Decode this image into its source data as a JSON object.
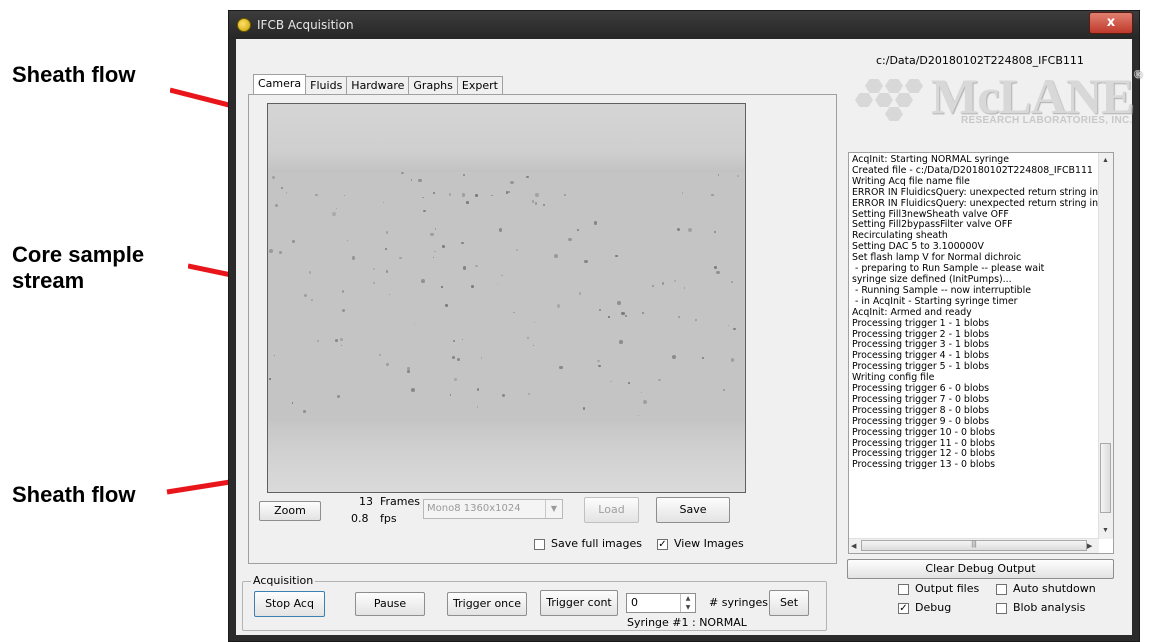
{
  "annotations": {
    "top": "Sheath flow",
    "middle": "Core sample\nstream",
    "bottom": "Sheath flow"
  },
  "window": {
    "title": "IFCB Acquisition",
    "close_glyph": "x"
  },
  "file_path": "c:/Data/D20180102T224808_IFCB111",
  "logo": {
    "word": "McLANE",
    "registered": "®",
    "subtitle": "RESEARCH LABORATORIES, INC."
  },
  "tabs": [
    {
      "label": "Camera",
      "active": true
    },
    {
      "label": "Fluids"
    },
    {
      "label": "Hardware"
    },
    {
      "label": "Graphs"
    },
    {
      "label": "Expert"
    }
  ],
  "camera": {
    "zoom_label": "Zoom",
    "frames_count": "13",
    "frames_label": "Frames",
    "fps_value": "0.8",
    "fps_label": "fps",
    "format_select": "Mono8 1360x1024",
    "load_label": "Load",
    "save_label": "Save",
    "save_full_images_label": "Save full images",
    "save_full_images_checked": false,
    "view_images_label": "View Images",
    "view_images_checked": true
  },
  "log": {
    "lines": [
      "AcqInit: Starting NORMAL syringe",
      "Created file - c:/Data/D20180102T224808_IFCB111",
      "Writing Acq file name file",
      "ERROR IN FluidicsQuery: unexpected return string in",
      "ERROR IN FluidicsQuery: unexpected return string in",
      "Setting Fill3newSheath valve OFF",
      "Setting Fill2bypassFilter valve OFF",
      "Recirculating sheath",
      "Setting DAC 5 to 3.100000V",
      "Set flash lamp V for Normal dichroic",
      " - preparing to Run Sample -- please wait",
      "syringe size defined (InitPumps)...",
      " - Running Sample -- now interruptible",
      " - in AcqInit - Starting syringe timer",
      "AcqInit: Armed and ready",
      "Processing trigger 1 - 1 blobs",
      "Processing trigger 2 - 1 blobs",
      "Processing trigger 3 - 1 blobs",
      "Processing trigger 4 - 1 blobs",
      "Processing trigger 5 - 1 blobs",
      "Writing config file",
      "Processing trigger 6 - 0 blobs",
      "Processing trigger 7 - 0 blobs",
      "Processing trigger 8 - 0 blobs",
      "Processing trigger 9 - 0 blobs",
      "Processing trigger 10 - 0 blobs",
      "Processing trigger 11 - 0 blobs",
      "Processing trigger 12 - 0 blobs",
      "Processing trigger 13 - 0 blobs"
    ],
    "clear_label": "Clear Debug Output"
  },
  "acquisition": {
    "group_label": "Acquisition",
    "stop_label": "Stop Acq",
    "pause_label": "Pause",
    "trigger_once_label": "Trigger once",
    "trigger_cont_label": "Trigger cont",
    "syringes_value": "0",
    "syringes_label": "# syringes",
    "set_label": "Set",
    "syringe_status": "Syringe #1 : NORMAL"
  },
  "options": {
    "output_files_label": "Output files",
    "output_files_checked": false,
    "auto_shutdown_label": "Auto shutdown",
    "auto_shutdown_checked": false,
    "debug_label": "Debug",
    "debug_checked": true,
    "blob_analysis_label": "Blob analysis",
    "blob_analysis_checked": false
  },
  "colors": {
    "arrow": "#e8161b",
    "window_frame": "#2b2b2b",
    "close_button": "#c0392b"
  }
}
